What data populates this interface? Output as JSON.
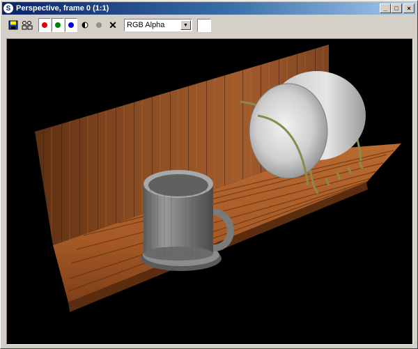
{
  "window": {
    "title": "Perspective, frame 0 (1:1)",
    "app_icon_glyph": "S",
    "minimize_glyph": "_",
    "maximize_glyph": "□",
    "close_glyph": "×"
  },
  "toolbar": {
    "channel_colors": {
      "red": "#e00000",
      "green": "#008000",
      "blue": "#0000e0",
      "mono": "#909090"
    },
    "channel_select": {
      "value": "RGB Alpha",
      "arrow_glyph": "▼"
    },
    "clear_glyph": "✕",
    "swatch_color": "#ffffff"
  },
  "render": {
    "wood_color": "#b06b36",
    "wood_dark": "#6e3b1a",
    "mug_color": "#8a8a8a",
    "bowl_color": "#d8d8d8",
    "rack_color": "#7a7a40"
  }
}
